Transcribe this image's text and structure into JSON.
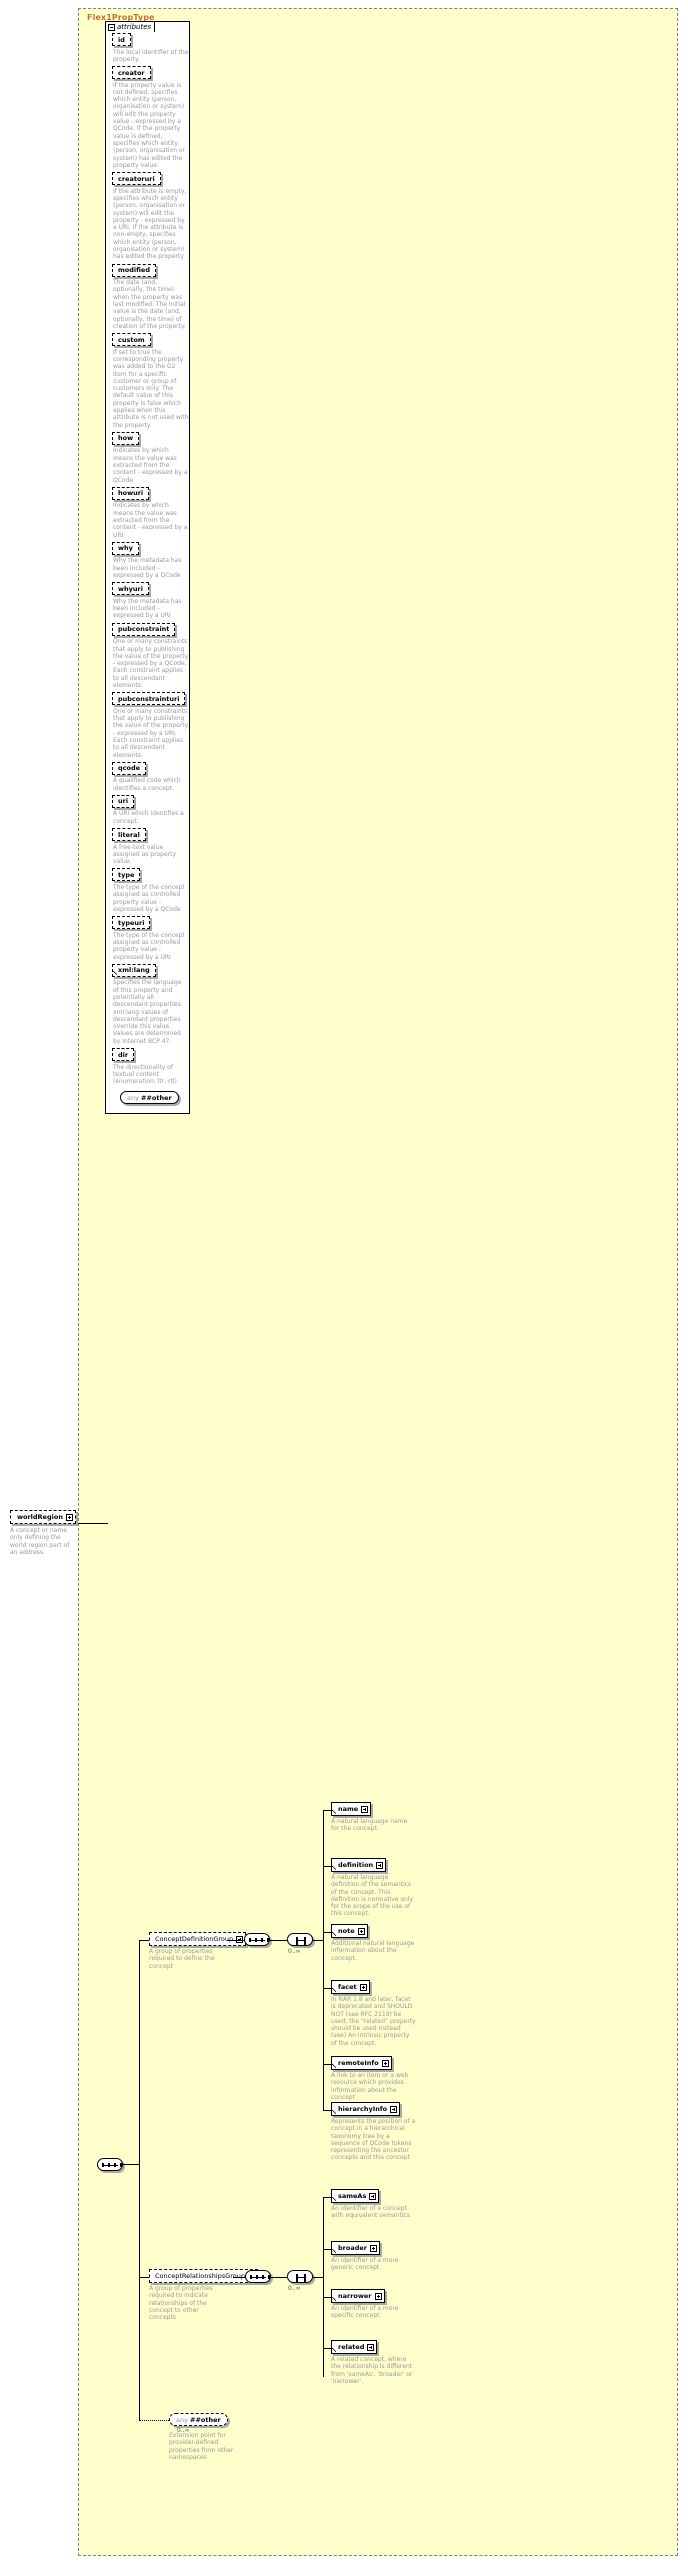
{
  "type_name": "Flex1PropType",
  "attributes_panel": {
    "tab_label": "attributes",
    "items": [
      {
        "name": "id",
        "doc": "The local identifier of the property."
      },
      {
        "name": "creator",
        "doc": "If the property value is not defined, specifies which entity (person, organisation or system) will edit the property value - expressed by a QCode. If the property value is defined, specifies which entity (person, organisation or system) has edited the property value."
      },
      {
        "name": "creatoruri",
        "doc": "If the attribute is empty, specifies which entity (person, organisation or system) will edit the property - expressed by a URI. If the attribute is non-empty, specifies which entity (person, organisation or system) has edited the property."
      },
      {
        "name": "modified",
        "doc": "The date (and, optionally, the time) when the property was last modified. The initial value is the date (and, optionally, the time) of creation of the property."
      },
      {
        "name": "custom",
        "doc": "If set to true the corresponding property was added to the G2 Item for a specific customer or group of customers only. The default value of this property is false which applies when this attribute is not used with the property."
      },
      {
        "name": "how",
        "doc": "Indicates by which means the value was extracted from the content - expressed by a QCode"
      },
      {
        "name": "howuri",
        "doc": "Indicates by which means the value was extracted from the content - expressed by a URI"
      },
      {
        "name": "why",
        "doc": "Why the metadata has been included - expressed by a QCode"
      },
      {
        "name": "whyuri",
        "doc": "Why the metadata has been included - expressed by a URI"
      },
      {
        "name": "pubconstraint",
        "doc": "One or many constraints that apply to publishing the value of the property - expressed by a QCode. Each constraint applies to all descendant elements."
      },
      {
        "name": "pubconstrainturi",
        "doc": "One or many constraints that apply to publishing the value of the property - expressed by a URI. Each constraint applies to all descendant elements."
      },
      {
        "name": "qcode",
        "doc": "A qualified code which identifies a concept."
      },
      {
        "name": "uri",
        "doc": "A URI which identifies a concept."
      },
      {
        "name": "literal",
        "doc": "A free-text value assigned as property value."
      },
      {
        "name": "type",
        "doc": "The type of the concept assigned as controlled property value - expressed by a QCode"
      },
      {
        "name": "typeuri",
        "doc": "The type of the concept assigned as controlled property value - expressed by a URI"
      },
      {
        "name": "xml:lang",
        "doc": "Specifies the language of this property and potentially all descendant properties. xml:lang values of descendant properties override this value. Values are determined by Internet BCP 47.",
        "arrow": true
      },
      {
        "name": "dir",
        "doc": "The directionality of textual content (enumeration: ltr, rtl)"
      }
    ],
    "any_attribute": {
      "keyword": "any",
      "namespace": "##other"
    }
  },
  "left_element": {
    "name": "worldRegion",
    "doc": "A concept or name only defining the world region part of an address."
  },
  "groups": [
    {
      "name": "ConceptDefinitionGroup",
      "doc": "A group of properties required to define the concept",
      "cardinality": "0..∞",
      "members": [
        {
          "name": "name",
          "doc": "A natural language name for the concept."
        },
        {
          "name": "definition",
          "doc": "A natural language definition of the semantics of the concept. This definition is normative only for the scope of the use of this concept."
        },
        {
          "name": "note",
          "doc": "Additional natural language information about the concept."
        },
        {
          "name": "facet",
          "doc": "In NAR 1.8 and later, facet is deprecated and SHOULD NOT (see RFC 2119) be used, the “related” property should be used instead (see) An intrinsic property of the concept."
        },
        {
          "name": "remoteInfo",
          "doc": "A link to an item or a web resource which provides information about the concept"
        },
        {
          "name": "hierarchyInfo",
          "doc": "Represents the position of a concept in a hierarchical taxonomy tree by a sequence of QCode tokens representing the ancestor concepts and this concept"
        }
      ]
    },
    {
      "name": "ConceptRelationshipsGroup",
      "doc": "A group of properties required to indicate relationships of the concept to other concepts",
      "cardinality": "0..∞",
      "members": [
        {
          "name": "sameAs",
          "doc": "An identifier of a concept with equivalent semantics"
        },
        {
          "name": "broader",
          "doc": "An identifier of a more generic concept."
        },
        {
          "name": "narrower",
          "doc": "An identifier of a more specific concept."
        },
        {
          "name": "related",
          "doc": "A related concept, where the relationship is different from 'sameAs', 'broader' or 'narrower'."
        }
      ]
    }
  ],
  "any_element": {
    "keyword": "any",
    "namespace": "##other",
    "cardinality": "0..∞",
    "doc": "Extension point for provider-defined properties from other namespaces"
  },
  "icons": {
    "collapse": "minus-box-icon",
    "expand": "plus-box-icon",
    "sequence": "sequence-compositor-icon",
    "choice": "choice-compositor-icon"
  },
  "colors": {
    "type_background": "#FFFFCC",
    "type_title": "#C87137",
    "doc_text": "#9A9A9A",
    "border": "#000000"
  }
}
